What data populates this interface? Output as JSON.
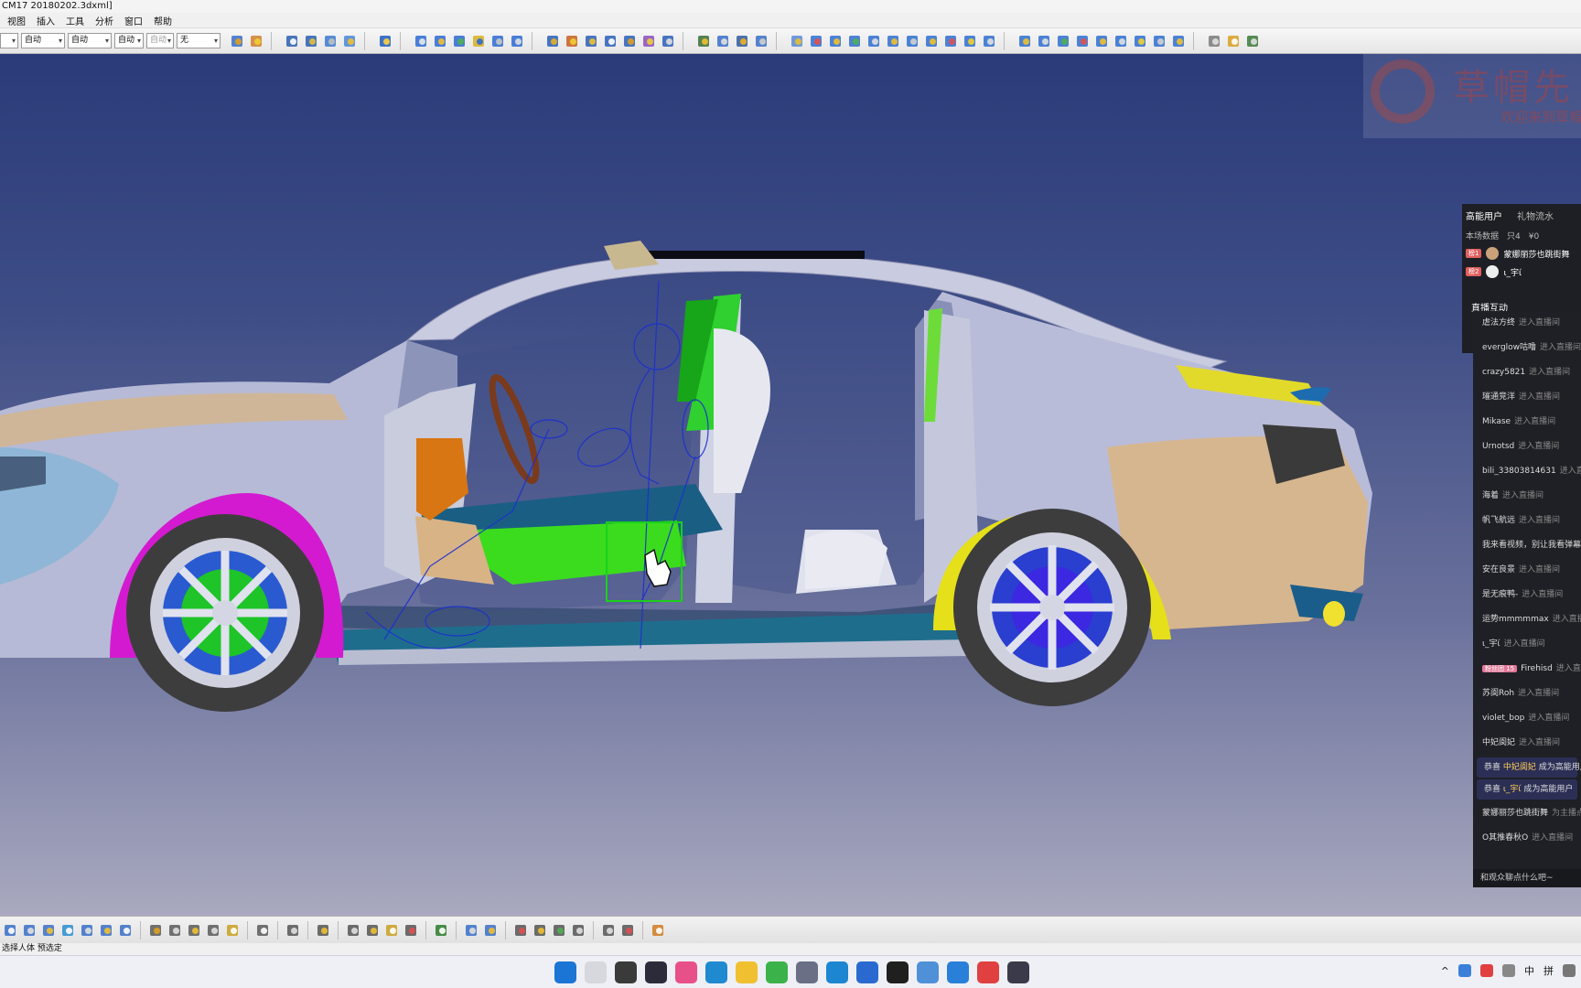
{
  "window": {
    "title": "CM17 20180202.3dxml]"
  },
  "menu": [
    "视图",
    "插入",
    "工具",
    "分析",
    "窗口",
    "帮助"
  ],
  "toolbar_top": {
    "combos": [
      {
        "value": "自动",
        "disabled": false
      },
      {
        "value": "自动",
        "disabled": false
      },
      {
        "value": "自动",
        "disabled": false
      },
      {
        "value": "自动",
        "disabled": true
      },
      {
        "value": "无",
        "disabled": false
      }
    ]
  },
  "watermark": {
    "title": "草帽先",
    "subtitle": "欢迎来到草帽"
  },
  "live_panel": {
    "tabs": [
      "高能用户",
      "礼物流水"
    ],
    "stats": "本场数据　只4　¥0",
    "top_users": [
      {
        "rank": "榜1",
        "name": "蒙娜丽莎也跳街舞"
      },
      {
        "rank": "榜2",
        "name": "ι_宇ί"
      }
    ],
    "interact_label": "直播互动"
  },
  "chat": {
    "entries": [
      {
        "name": "虐法方终",
        "action": "进入直播间"
      },
      {
        "name": "everglow咕噜",
        "action": "进入直播间"
      },
      {
        "name": "crazy5821",
        "action": "进入直播间"
      },
      {
        "name": "璀通竞洋",
        "action": "进入直播间"
      },
      {
        "name": "Mikase",
        "action": "进入直播间"
      },
      {
        "name": "Urnotsd",
        "action": "进入直播间"
      },
      {
        "name": "bili_33803814631",
        "action": "进入直播间"
      },
      {
        "name": "海着",
        "action": "进入直播间"
      },
      {
        "name": "帆飞航远",
        "action": "进入直播间"
      },
      {
        "name": "我来看视频，别让我看弹幕",
        "action": ""
      },
      {
        "name": "安在良景",
        "action": "进入直播间"
      },
      {
        "name": "是无痕鸭-",
        "action": "进入直播间"
      },
      {
        "name": "运势mmmmmax",
        "action": "进入直播间"
      },
      {
        "name": "ι_宇ί",
        "action": "进入直播间"
      },
      {
        "name": "Firehisd",
        "action": "进入直播间",
        "badge": "粉丝团 15"
      },
      {
        "name": "苏阆Roh",
        "action": "进入直播间"
      },
      {
        "name": "violet_bop",
        "action": "进入直播间"
      },
      {
        "name": "中妃阆妃",
        "action": "进入直播间"
      }
    ],
    "highlights": [
      {
        "prefix": "恭喜",
        "name": "中妃阆妃",
        "suffix": "成为高能用户"
      },
      {
        "prefix": "恭喜",
        "name": "ι_宇ί",
        "suffix": "成为高能用户"
      }
    ],
    "tail": [
      {
        "name": "蒙娜丽莎也跳街舞",
        "action": "为主播点赞"
      },
      {
        "name": "O其推春秋O",
        "action": "进入直播间"
      }
    ],
    "footer": "和观众聊点什么吧~"
  },
  "statusbar": {
    "text": "选择人体 预选定"
  },
  "taskbar": {
    "tray": [
      "中",
      "拼"
    ]
  }
}
